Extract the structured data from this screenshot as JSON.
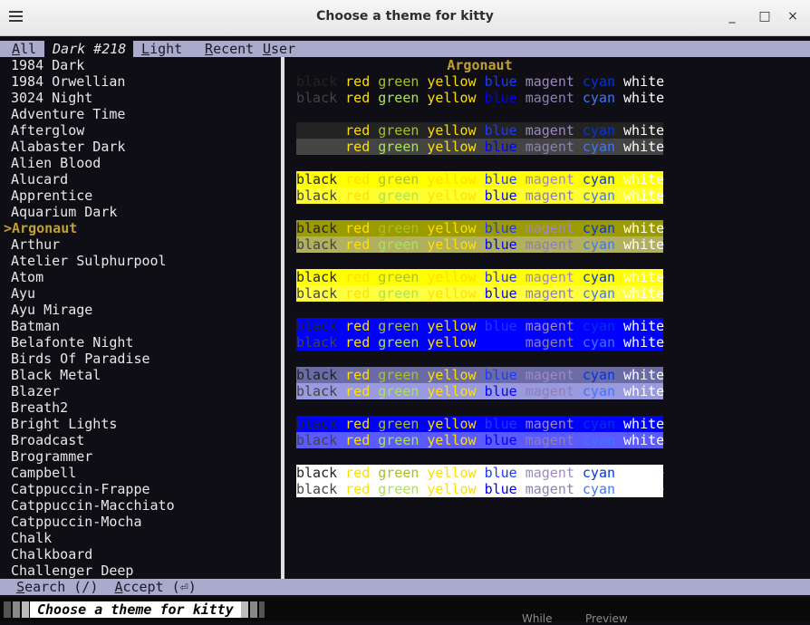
{
  "window": {
    "title": "Choose a theme for kitty",
    "minimize": "_",
    "maximize": "□",
    "close": "×"
  },
  "tabs": [
    {
      "key": "A",
      "rest": "ll",
      "label": "All",
      "active": false
    },
    {
      "key": "",
      "rest": "",
      "label": "Dark #218",
      "active": true
    },
    {
      "key": "L",
      "rest": "ight",
      "label": "Light",
      "active": false
    },
    {
      "key": "R",
      "rest": "ecent",
      "label": "Recent",
      "active": false
    },
    {
      "key": "U",
      "rest": "ser",
      "label": "User",
      "active": false
    }
  ],
  "themes": [
    "1984 Dark",
    "1984 Orwellian",
    "3024 Night",
    "Adventure Time",
    "Afterglow",
    "Alabaster Dark",
    "Alien Blood",
    "Alucard",
    "Apprentice",
    "Aquarium Dark",
    ">Argonaut",
    "Arthur",
    "Atelier Sulphurpool",
    "Atom",
    "Ayu",
    "Ayu Mirage",
    "Batman",
    "Belafonte Night",
    "Birds Of Paradise",
    "Black Metal",
    "Blazer",
    "Breath2",
    "Bright Lights",
    "Broadcast",
    "Brogrammer",
    "Campbell",
    "Catppuccin-Frappe",
    "Catppuccin-Macchiato",
    "Catppuccin-Mocha",
    "Chalk",
    "Chalkboard",
    "Challenger Deep"
  ],
  "selected_index": 10,
  "preview": {
    "title": "Argonaut",
    "words": [
      "black",
      "red",
      "green",
      "yellow",
      "blue",
      "magent",
      "cyan",
      "white"
    ],
    "colors": {
      "normal": [
        "#232323",
        "#ffdd00",
        "#a8c023",
        "#ffdd00",
        "#1e38ff",
        "#9c8ac0",
        "#0035e0",
        "#ffffff"
      ],
      "bright": [
        "#444444",
        "#ffe000",
        "#abe15b",
        "#ffe000",
        "#0000ff",
        "#8e80b0",
        "#3f76ff",
        "#ffffff"
      ]
    },
    "backgrounds": [
      "#0e0e14",
      "#232323",
      "#ffff00",
      "#9b9b00",
      "#ffff00",
      "#0000ff",
      "#6b6ba8",
      "#0000ff",
      "#ffffff"
    ],
    "bright_backgrounds": [
      "#0e0e14",
      "#444444",
      "#ffff30",
      "#b0b060",
      "#ffff40",
      "#0000ff",
      "#9a9ae0",
      "#5a5aff",
      "#ffffff"
    ]
  },
  "statusbar": {
    "search_key": "S",
    "search_rest": "earch (/)",
    "accept_key": "A",
    "accept_rest": "ccept (⏎)"
  },
  "bottom": {
    "title": "Choose a theme for kitty",
    "ghost1": "While",
    "ghost2": "Preview"
  }
}
